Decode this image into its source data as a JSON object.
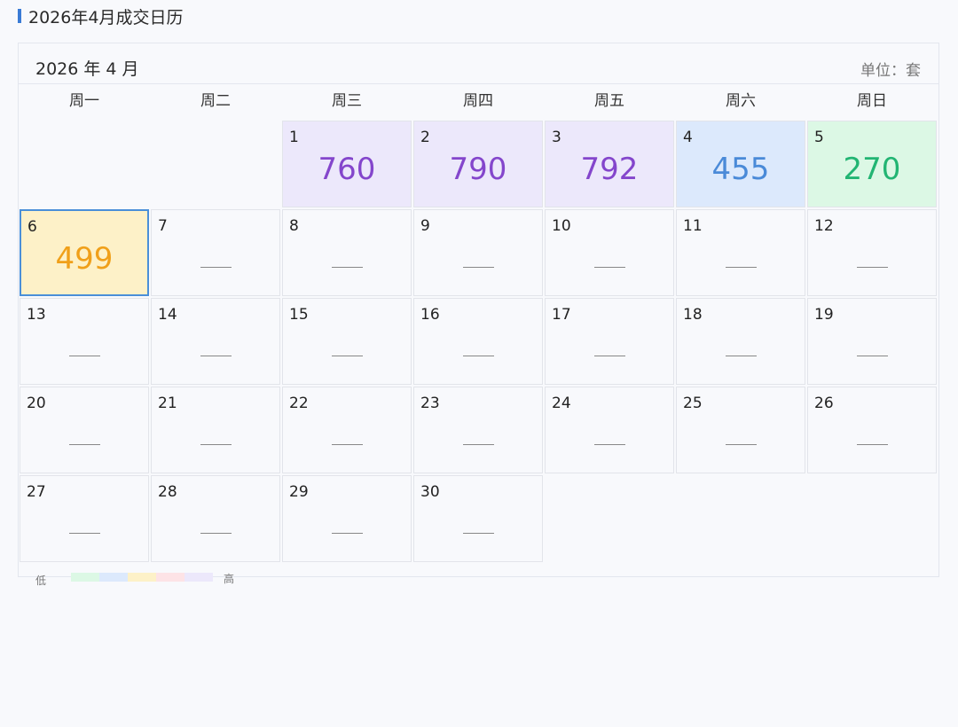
{
  "page_title": "2026年4月成交日历",
  "calendar": {
    "month_label": "2026 年 4 月",
    "unit_label": "单位：套",
    "weekdays": [
      "周一",
      "周二",
      "周三",
      "周四",
      "周五",
      "周六",
      "周日"
    ],
    "first_weekday_index": 2,
    "empty_marker": "——",
    "selected_day": 6,
    "days": [
      {
        "day": "1",
        "value": "760",
        "bg": "#ece8fb",
        "color": "#8446cc"
      },
      {
        "day": "2",
        "value": "790",
        "bg": "#ece8fb",
        "color": "#8446cc"
      },
      {
        "day": "3",
        "value": "792",
        "bg": "#ece8fb",
        "color": "#8446cc"
      },
      {
        "day": "4",
        "value": "455",
        "bg": "#dce9fc",
        "color": "#4a8ad8"
      },
      {
        "day": "5",
        "value": "270",
        "bg": "#dcf8e5",
        "color": "#22b573"
      },
      {
        "day": "6",
        "value": "499",
        "bg": "#fdf1c8",
        "color": "#f0a01a"
      },
      {
        "day": "7",
        "value": null
      },
      {
        "day": "8",
        "value": null
      },
      {
        "day": "9",
        "value": null
      },
      {
        "day": "10",
        "value": null
      },
      {
        "day": "11",
        "value": null
      },
      {
        "day": "12",
        "value": null
      },
      {
        "day": "13",
        "value": null
      },
      {
        "day": "14",
        "value": null
      },
      {
        "day": "15",
        "value": null
      },
      {
        "day": "16",
        "value": null
      },
      {
        "day": "17",
        "value": null
      },
      {
        "day": "18",
        "value": null
      },
      {
        "day": "19",
        "value": null
      },
      {
        "day": "20",
        "value": null
      },
      {
        "day": "21",
        "value": null
      },
      {
        "day": "22",
        "value": null
      },
      {
        "day": "23",
        "value": null
      },
      {
        "day": "24",
        "value": null
      },
      {
        "day": "25",
        "value": null
      },
      {
        "day": "26",
        "value": null
      },
      {
        "day": "27",
        "value": null
      },
      {
        "day": "28",
        "value": null
      },
      {
        "day": "29",
        "value": null
      },
      {
        "day": "30",
        "value": null
      }
    ]
  },
  "legend": {
    "low_label": "低",
    "high_label": "高",
    "colors": [
      "#dcf8e5",
      "#dce9fc",
      "#fdf1c8",
      "#fde3e6",
      "#ece8fb"
    ]
  },
  "colors": {
    "accent": "#3a7bd5",
    "selected_border": "#4a8fd8"
  }
}
